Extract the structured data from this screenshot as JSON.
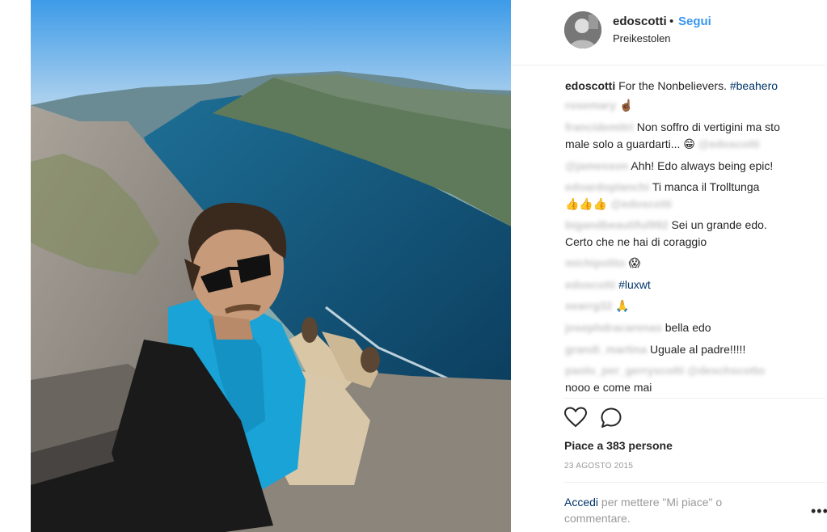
{
  "post": {
    "username": "edoscotti",
    "separator": "•",
    "follow_label": "Segui",
    "location": "Preikestolen",
    "caption": {
      "user": "edoscotti",
      "text": "For the Nonbelievers. ",
      "hashtag": "#beahero"
    }
  },
  "comments": [
    {
      "user": "rosemary",
      "text": "",
      "emoji": "☝🏾"
    },
    {
      "user": "francidemitri",
      "text": "Non soffro di vertigini ma sto"
    },
    {
      "user": "",
      "text": "male solo a guardarti... ",
      "emoji": "😁",
      "mention": "@edoscotti"
    },
    {
      "user": "@jamesson",
      "text": "Ahh! Edo always being epic!"
    },
    {
      "user": "edoardoplanchi",
      "text": "Ti manca il Trolltunga"
    },
    {
      "user": "",
      "text": "",
      "emoji": "👍👍👍",
      "mention": "@edoscotti"
    },
    {
      "user": "bigandbeautiful992",
      "text": "Sei un grande edo."
    },
    {
      "user": "",
      "text": "Certo che ne hai di coraggio"
    },
    {
      "user": "michipolito",
      "text": "",
      "emoji": "😱"
    },
    {
      "user": "edoscotti",
      "text": "",
      "hashtag": "#luxwt"
    },
    {
      "user": "searrg32",
      "text": "",
      "emoji": "🙏"
    },
    {
      "user": "josephdracarenas",
      "text": "bella edo"
    },
    {
      "user": "grandi_martina",
      "text": "Uguale al padre!!!!!"
    },
    {
      "user": "paolo_per_gerryscotti",
      "text": "",
      "mention": "@deschscotto"
    },
    {
      "user": "",
      "text": "nooo e come mai"
    }
  ],
  "actions": {
    "like_icon": "heart-icon",
    "comment_icon": "comment-bubble-icon",
    "likes_text": "Piace a 383 persone",
    "date": "23 AGOSTO 2015"
  },
  "footer": {
    "login_link": "Accedi",
    "login_text": " per mettere \"Mi piace\" o commentare.",
    "more": "•••"
  }
}
